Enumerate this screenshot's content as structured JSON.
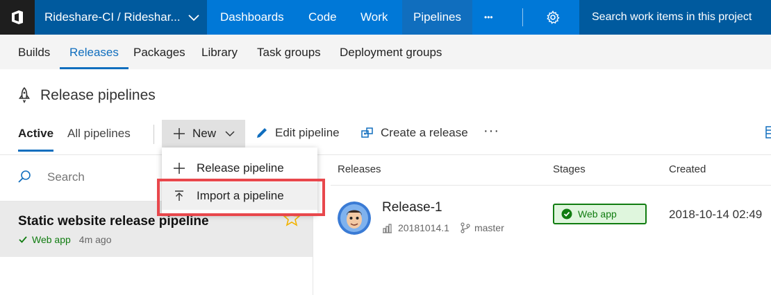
{
  "topbar": {
    "project": "Rideshare-CI / Rideshar...",
    "nav": [
      "Dashboards",
      "Code",
      "Work",
      "Pipelines"
    ],
    "active_nav": "Pipelines",
    "more": "•••",
    "search_placeholder": "Search work items in this project"
  },
  "subnav": [
    "Builds",
    "Releases",
    "Packages",
    "Library",
    "Task groups",
    "Deployment groups"
  ],
  "page": {
    "title": "Release pipelines"
  },
  "toolbar": {
    "tab_active": "Active",
    "tab_all": "All pipelines",
    "new_label": "New",
    "edit_label": "Edit pipeline",
    "create_label": "Create a release",
    "more": "···"
  },
  "dropdown": {
    "items": [
      "Release pipeline",
      "Import a pipeline"
    ]
  },
  "left": {
    "search_placeholder": "Search",
    "pipeline": {
      "name": "Static website release pipeline",
      "status": "Web app",
      "time": "4m ago"
    }
  },
  "table": {
    "headers": {
      "releases": "Releases",
      "stages": "Stages",
      "created": "Created"
    },
    "row": {
      "release": "Release-1",
      "build": "20181014.1",
      "branch": "master",
      "stage": "Web app",
      "created": "2018-10-14 02:49"
    }
  },
  "colors": {
    "accent": "#0078d7",
    "success": "#107c10",
    "highlight": "#e8474c"
  }
}
